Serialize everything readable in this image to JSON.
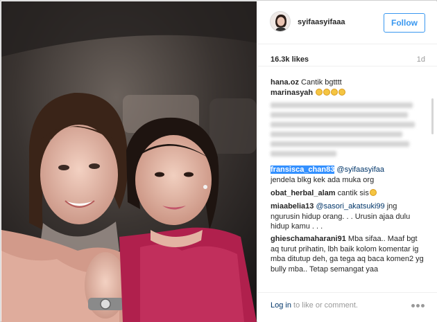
{
  "post": {
    "username": "syifaasyifaaa",
    "follow_label": "Follow",
    "likes": "16.3k likes",
    "time_ago": "1d"
  },
  "comments": [
    {
      "user": "hana.oz",
      "text": "Cantik bgtttt"
    },
    {
      "user": "marinasyah",
      "text": ""
    },
    {
      "user": "fransisca_chan83",
      "mention": "@syifaasyifaa",
      "text": "jendela blkg kek ada muka org"
    },
    {
      "user": "obat_herbal_alam",
      "text": "cantik sis"
    },
    {
      "user": "miaabelia13",
      "mention": "@sasori_akatsuki99",
      "text": "jng ngurusin hidup orang. . . Urusin ajaa dulu hidup kamu . . ."
    },
    {
      "user": "ghieschamaharani91",
      "text": "Mba sifaa.. Maaf bgt aq turut prihatin, lbh baik kolom komentar ig mba ditutup deh, ga tega aq baca komen2 yg bully mba.. Tetap semangat yaa"
    }
  ],
  "footer": {
    "login_link": "Log in",
    "login_rest": "to like or comment."
  },
  "icons": {
    "more": "more-options-icon",
    "emoji": "smiling-face-emoji-icon"
  },
  "colors": {
    "accent": "#3897f0",
    "link": "#003569",
    "muted": "#999999",
    "selection": "#3390ff"
  }
}
